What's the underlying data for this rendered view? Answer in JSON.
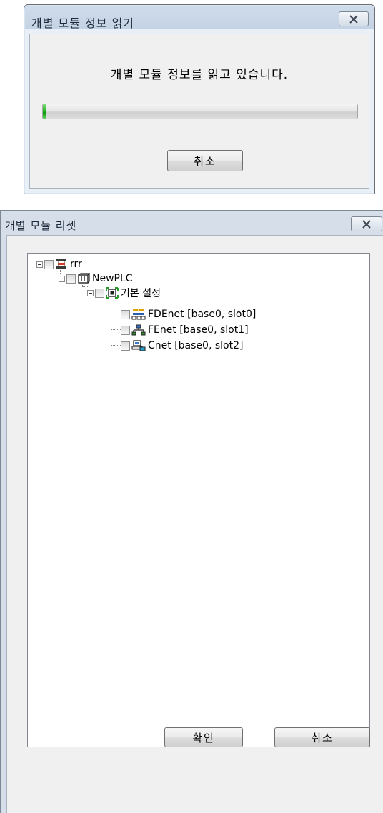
{
  "read_dialog": {
    "title": "개별 모듈 정보 읽기",
    "message": "개별 모듈 정보를 읽고 있습니다.",
    "progress_fraction": 0.01,
    "progress_color": "#1fb41c",
    "cancel_label": "취소",
    "close_icon": "close-x-icon"
  },
  "reset_dialog": {
    "title": "개별 모듈 리셋",
    "close_icon": "close-x-icon",
    "tree": [
      {
        "label": "rrr",
        "icon": "network-root-icon",
        "level": 0,
        "expanded": true,
        "checked": false
      },
      {
        "label": "NewPLC",
        "icon": "plc-icon",
        "level": 1,
        "expanded": true,
        "checked": false
      },
      {
        "label": "기본 설정",
        "icon": "basic-settings-icon",
        "level": 2,
        "expanded": true,
        "checked": false
      },
      {
        "label": "FDEnet [base0, slot0]",
        "icon": "fdenet-module-icon",
        "level": 3,
        "checked": false
      },
      {
        "label": "FEnet [base0, slot1]",
        "icon": "fenet-module-icon",
        "level": 3,
        "checked": false
      },
      {
        "label": "Cnet [base0, slot2]",
        "icon": "cnet-module-icon",
        "level": 3,
        "checked": false
      }
    ],
    "ok_label": "확인",
    "cancel_label": "취소"
  }
}
